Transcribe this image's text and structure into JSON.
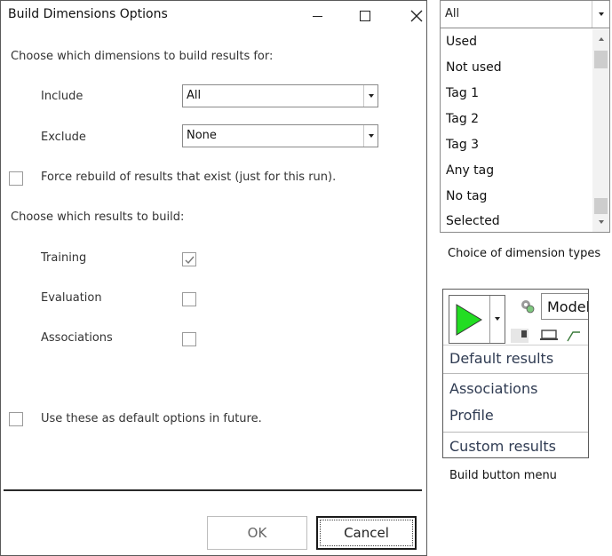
{
  "dialog": {
    "title": "Build Dimensions Options",
    "section1": "Choose which dimensions to build results for:",
    "include_label": "Include",
    "include_value": "All",
    "exclude_label": "Exclude",
    "exclude_value": "None",
    "force_rebuild_label": "Force rebuild of results that exist (just for this run).",
    "force_rebuild_checked": false,
    "section2": "Choose which results to build:",
    "results": [
      {
        "label": "Training",
        "checked": true
      },
      {
        "label": "Evaluation",
        "checked": false
      },
      {
        "label": "Associations",
        "checked": false
      }
    ],
    "default_label": "Use these as default options in future.",
    "default_checked": false,
    "ok_label": "OK",
    "cancel_label": "Cancel"
  },
  "dimension_dropdown": {
    "value": "All",
    "items": [
      "Used",
      "Not used",
      "Tag 1",
      "Tag 2",
      "Tag 3",
      "Any tag",
      "No tag",
      "Selected"
    ],
    "caption": "Choice of dimension types"
  },
  "build_menu": {
    "model_label": "Model",
    "play_color": "#22dd22",
    "items": [
      "Default results",
      "Associations",
      "Profile",
      "Custom results"
    ],
    "caption": "Build button menu"
  }
}
